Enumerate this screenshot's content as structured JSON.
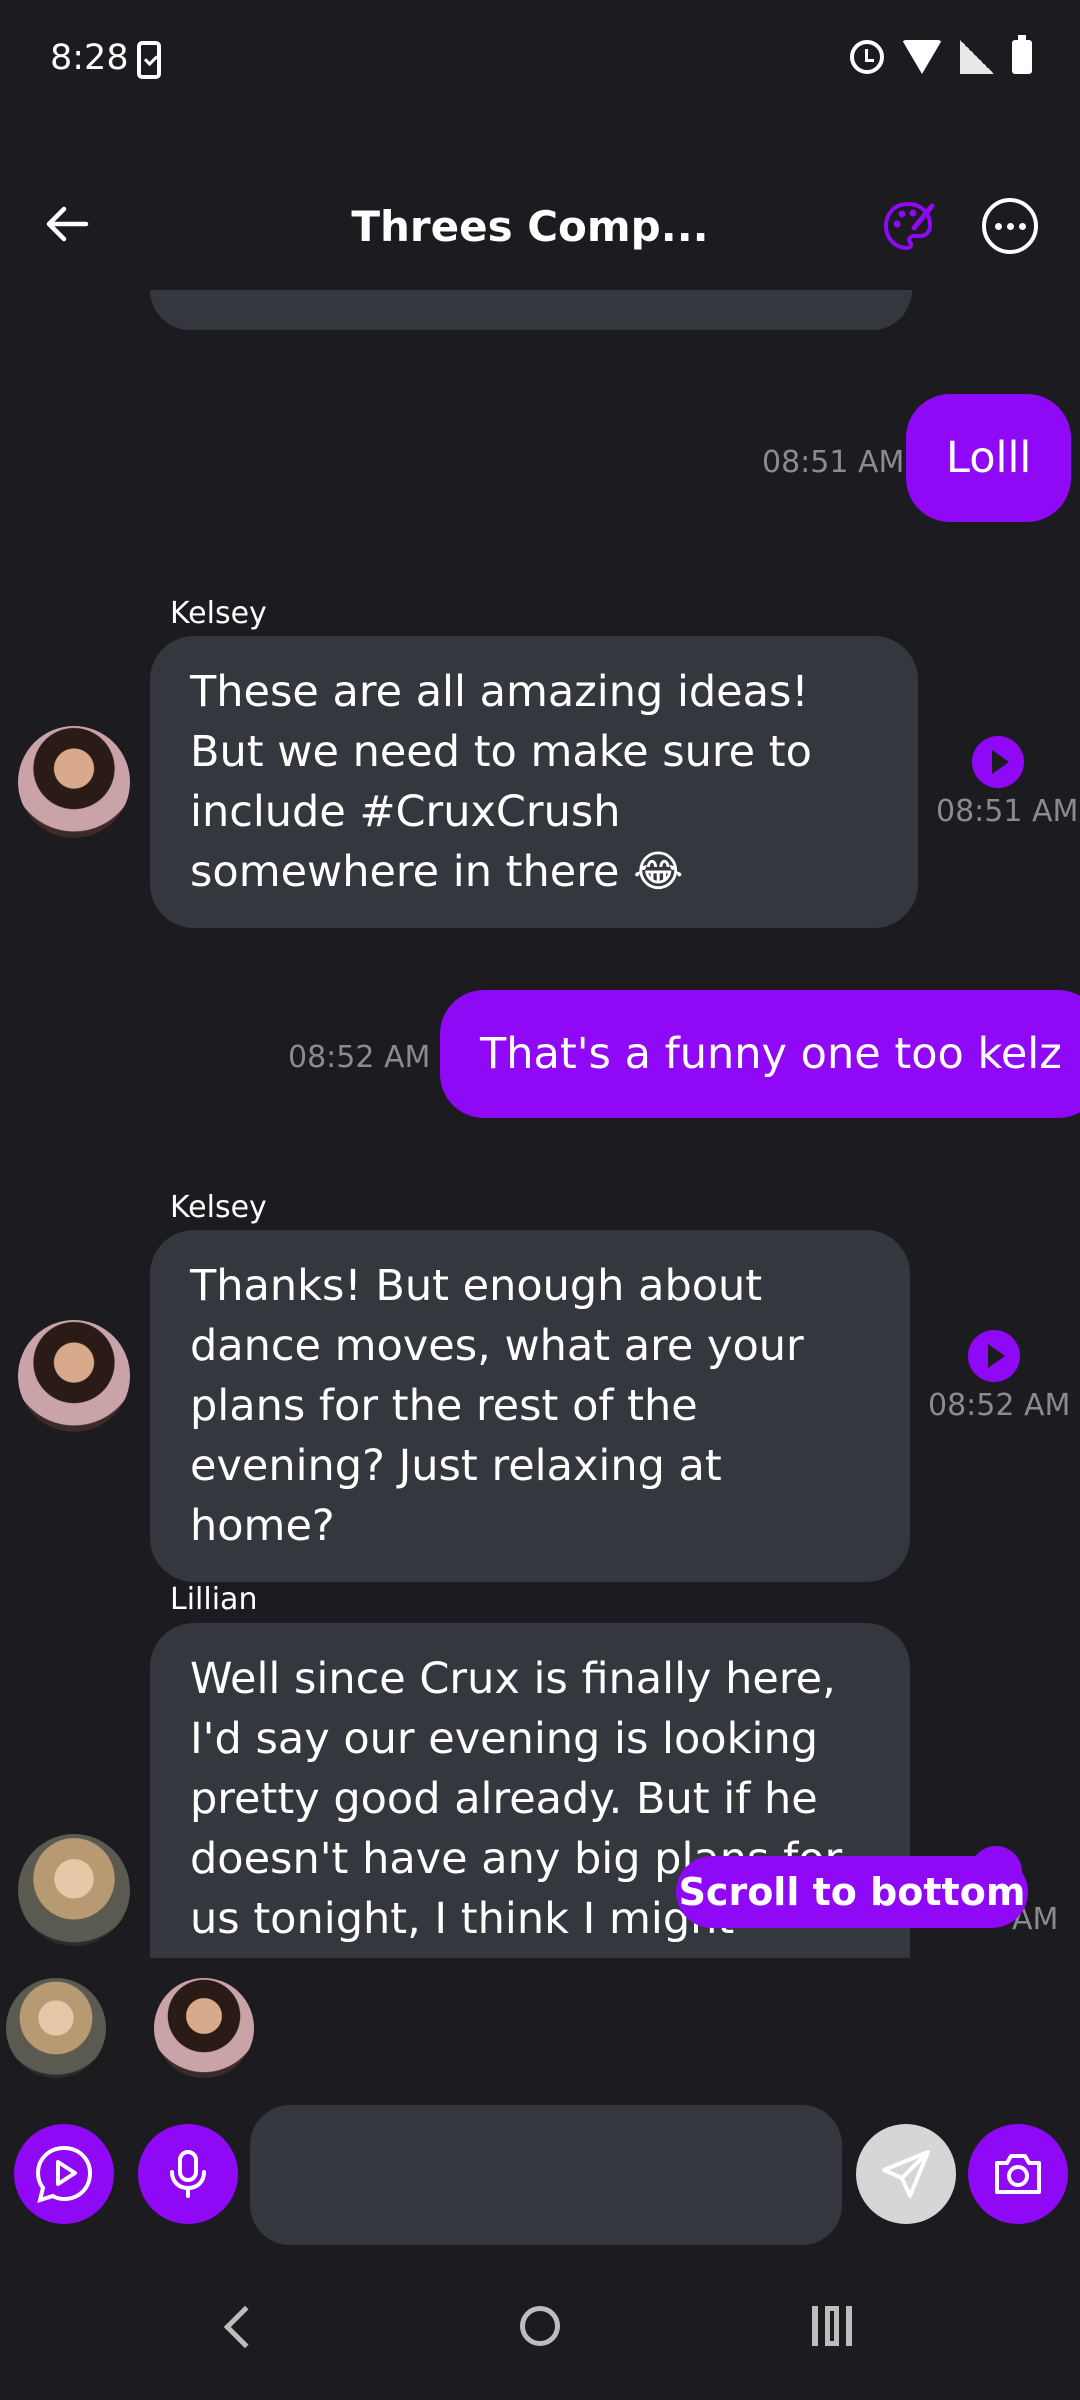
{
  "status_bar": {
    "time": "8:28"
  },
  "header": {
    "title": "Threes Comp..."
  },
  "messages": [
    {
      "type": "outgoing",
      "text": "Lolll",
      "time": "08:51 AM"
    },
    {
      "type": "incoming",
      "sender": "Kelsey",
      "text": "These are all amazing ideas! But we need to make sure to include #CruxCrush somewhere in there 😂",
      "time": "08:51 AM"
    },
    {
      "type": "outgoing",
      "text": "That's a funny one too kelz",
      "time": "08:52 AM"
    },
    {
      "type": "incoming",
      "sender": "Kelsey",
      "text": "Thanks! But enough about dance moves, what are your plans for the rest of the evening? Just relaxing at home?",
      "time": "08:52 AM"
    },
    {
      "type": "incoming",
      "sender": "Lillian",
      "text": "Well since Crux is finally here, I'd say our evening is looking pretty good already. But if he doesn't have any big plans for us tonight, I think I might suggest cuddling",
      "time": "AM"
    }
  ],
  "scroll_button": {
    "label": "Scroll to bottom"
  },
  "composer": {
    "placeholder": ""
  },
  "colors": {
    "accent": "#8f09f7",
    "background": "#1b1b20",
    "bubble_in": "#35373e",
    "send_disabled": "#d6d6d6"
  }
}
